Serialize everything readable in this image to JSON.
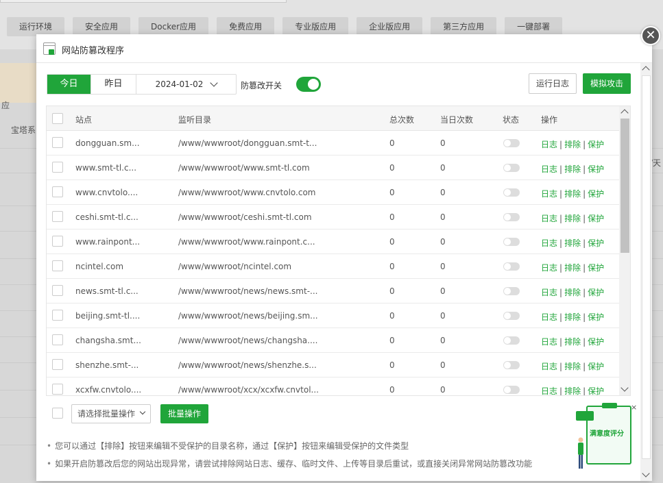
{
  "background": {
    "tabs": [
      "运行环境",
      "安全应用",
      "Docker应用",
      "免费应用",
      "专业版应用",
      "企业版应用",
      "第三方应用",
      "一键部署"
    ],
    "fragments": [
      "应",
      "宝塔系",
      "/天"
    ]
  },
  "modal": {
    "title": "网站防篡改程序",
    "toolbar": {
      "today": "今日",
      "yesterday": "昨日",
      "date": "2024-01-02",
      "toggle_label": "防篡改开关",
      "toggle_on": true,
      "log_button": "运行日志",
      "attack_button": "模拟攻击"
    },
    "table": {
      "headers": [
        "站点",
        "监听目录",
        "总次数",
        "当日次数",
        "状态",
        "操作"
      ],
      "ops": [
        "日志",
        "排除",
        "保护"
      ],
      "rows": [
        {
          "site": "dongguan.sm...",
          "dir": "/www/wwwroot/dongguan.smt-t...",
          "total": "0",
          "today": "0"
        },
        {
          "site": "www.smt-tl.c...",
          "dir": "/www/wwwroot/www.smt-tl.com",
          "total": "0",
          "today": "0"
        },
        {
          "site": "www.cnvtolo....",
          "dir": "/www/wwwroot/www.cnvtolo.com",
          "total": "0",
          "today": "0"
        },
        {
          "site": "ceshi.smt-tl.c...",
          "dir": "/www/wwwroot/ceshi.smt-tl.com",
          "total": "0",
          "today": "0"
        },
        {
          "site": "www.rainpont...",
          "dir": "/www/wwwroot/www.rainpont.c...",
          "total": "0",
          "today": "0"
        },
        {
          "site": "ncintel.com",
          "dir": "/www/wwwroot/ncintel.com",
          "total": "0",
          "today": "0"
        },
        {
          "site": "news.smt-tl.c...",
          "dir": "/www/wwwroot/news/news.smt-...",
          "total": "0",
          "today": "0"
        },
        {
          "site": "beijing.smt-tl....",
          "dir": "/www/wwwroot/news/beijing.sm...",
          "total": "0",
          "today": "0"
        },
        {
          "site": "changsha.smt...",
          "dir": "/www/wwwroot/news/changsha....",
          "total": "0",
          "today": "0"
        },
        {
          "site": "shenzhe.smt-...",
          "dir": "/www/wwwroot/news/shenzhe.s...",
          "total": "0",
          "today": "0"
        },
        {
          "site": "xcxfw.cnvtolo....",
          "dir": "/www/wwwroot/xcx/xcxfw.cnvtol...",
          "total": "0",
          "today": "0"
        }
      ]
    },
    "footer": {
      "batch_placeholder": "请选择批量操作",
      "batch_button": "批量操作",
      "tips": [
        "您可以通过【排除】按钮来编辑不受保护的目录名称，通过【保护】按钮来编辑受保护的文件类型",
        "如果开启防篡改后您的网站出现异常，请尝试排除网站日志、缓存、临时文件、上传等目录后重试，或直接关闭异常网站防篡改功能"
      ]
    },
    "satisfaction": {
      "label": "满意度评分",
      "close": "×"
    }
  },
  "colors": {
    "accent": "#20a53a",
    "overlay": "#d7d7d7"
  }
}
